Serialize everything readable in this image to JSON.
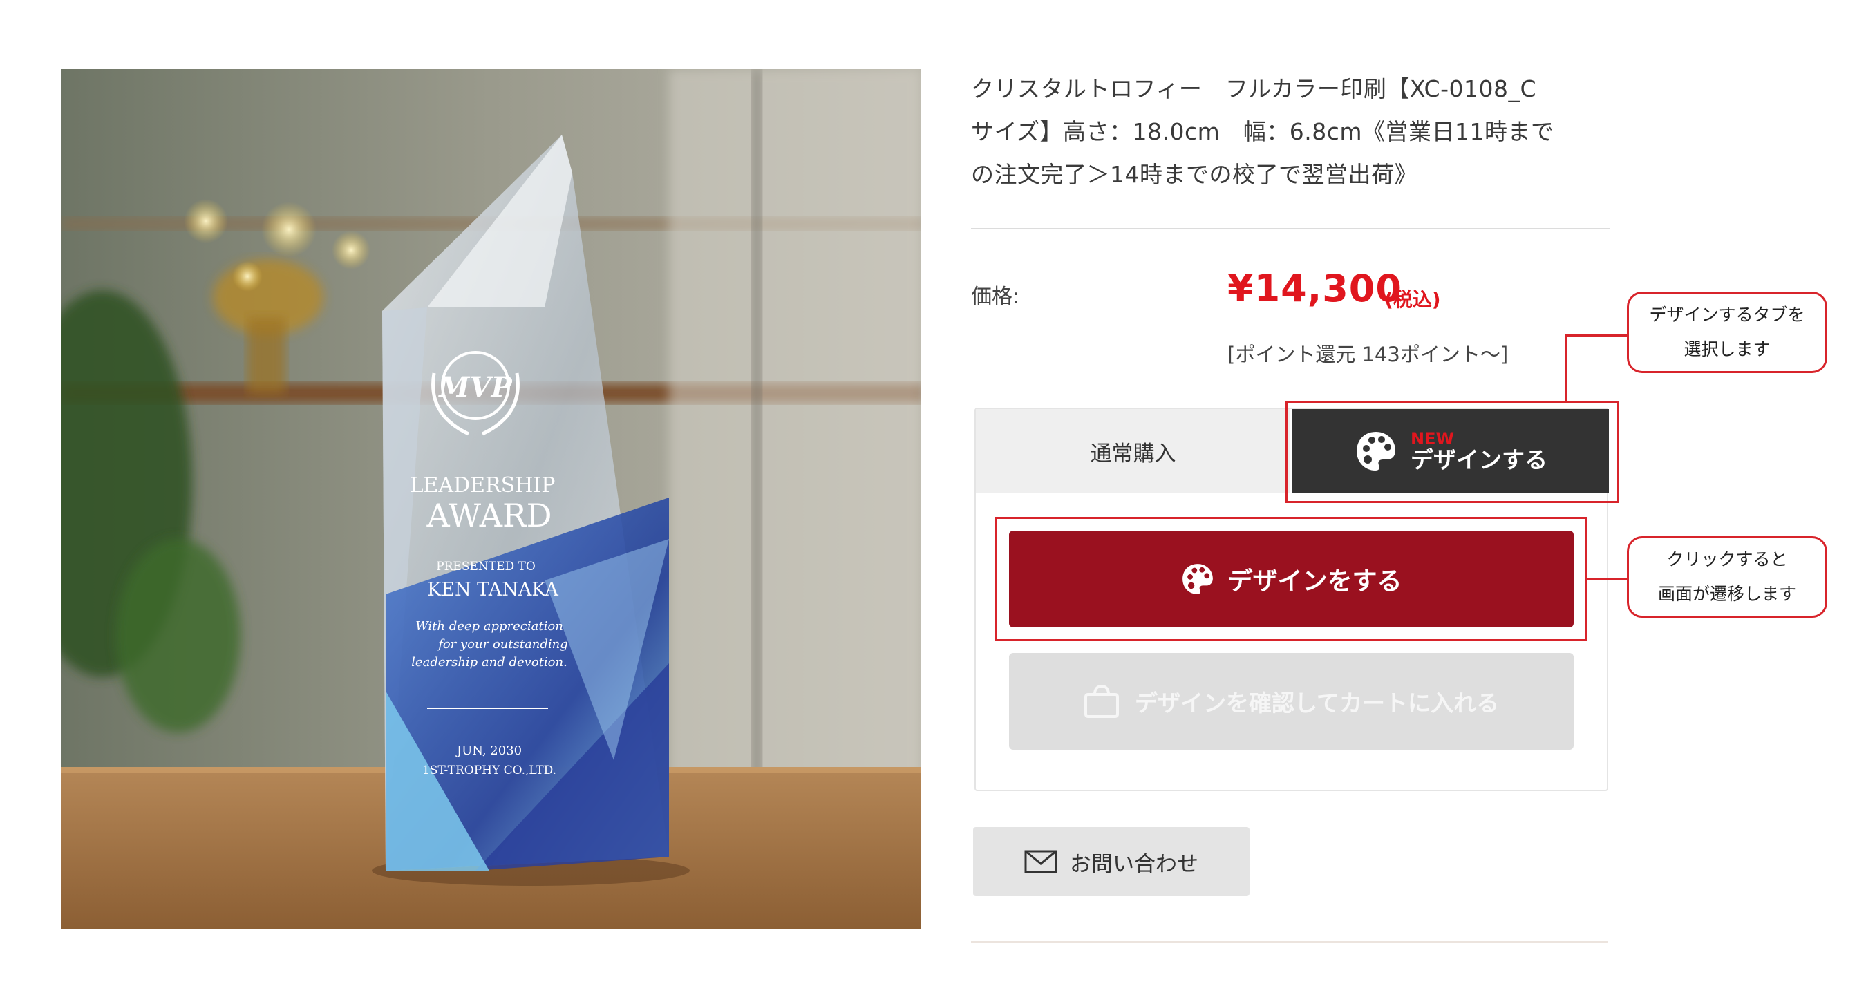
{
  "product": {
    "title_line1": "クリスタルトロフィー　フルカラー印刷【XC-0108_C",
    "title_line2": "サイズ】高さ：18.0cm　幅：6.8cm《営業日11時まで",
    "title_line3": "の注文完了＞14時までの校了で翌営出荷》",
    "price_label": "価格:",
    "price": "¥14,300",
    "tax_note": "(税込)",
    "points": "[ポイント還元 143ポイント〜]",
    "image_icon": "crystal-trophy-photo",
    "trophy_text": {
      "emblem": "MVP",
      "line1": "LEADERSHIP",
      "line2": "AWARD",
      "presented_to": "PRESENTED TO",
      "recipient": "KEN TANAKA",
      "message1": "With deep appreciation",
      "message2": "for your outstanding",
      "message3": "leadership and devotion.",
      "date": "JUN, 2030",
      "company": "1ST-TROPHY CO.,LTD."
    }
  },
  "tabs": {
    "normal": "通常購入",
    "design_badge": "NEW",
    "design": "デザインする",
    "design_icon": "palette-icon"
  },
  "buttons": {
    "design": "デザインをする",
    "design_icon": "palette-icon",
    "cart": "デザインを確認してカートに入れる",
    "cart_icon": "shopping-bag-icon",
    "contact": "お問い合わせ",
    "contact_icon": "mail-icon"
  },
  "annotations": {
    "tab_note_line1": "デザインするタブを",
    "tab_note_line2": "選択します",
    "button_note_line1": "クリックすると",
    "button_note_line2": "画面が遷移します"
  },
  "colors": {
    "price_red": "#e0161e",
    "design_button": "#9a111f",
    "tab_active": "#333333",
    "annotation_red": "#d8242b"
  }
}
